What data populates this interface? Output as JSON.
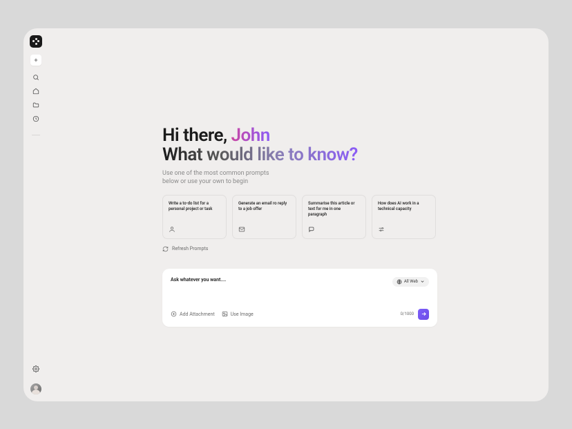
{
  "greeting": {
    "prefix": "Hi there, ",
    "name": "John",
    "question_word1": "What ",
    "question_rest": "would like to know?"
  },
  "subtitle": {
    "line1": "Use one of the most common prompts",
    "line2": "below or use your own to begin"
  },
  "prompt_cards": [
    {
      "text": "Write a to-do list for a personal project or task",
      "icon": "user-icon"
    },
    {
      "text": "Generate an email ro reply to a job offer",
      "icon": "mail-icon"
    },
    {
      "text": "Summarise this article or text for me in one paragraph",
      "icon": "chat-icon"
    },
    {
      "text": "How does AI work in a technical capacity",
      "icon": "sliders-icon"
    }
  ],
  "refresh_label": "Refresh Prompts",
  "chat_input": {
    "placeholder": "Ask whatever you want....",
    "source_label": "All Web",
    "add_attachment_label": "Add Attachment",
    "use_image_label": "Use Image",
    "char_count": "0/1000"
  }
}
